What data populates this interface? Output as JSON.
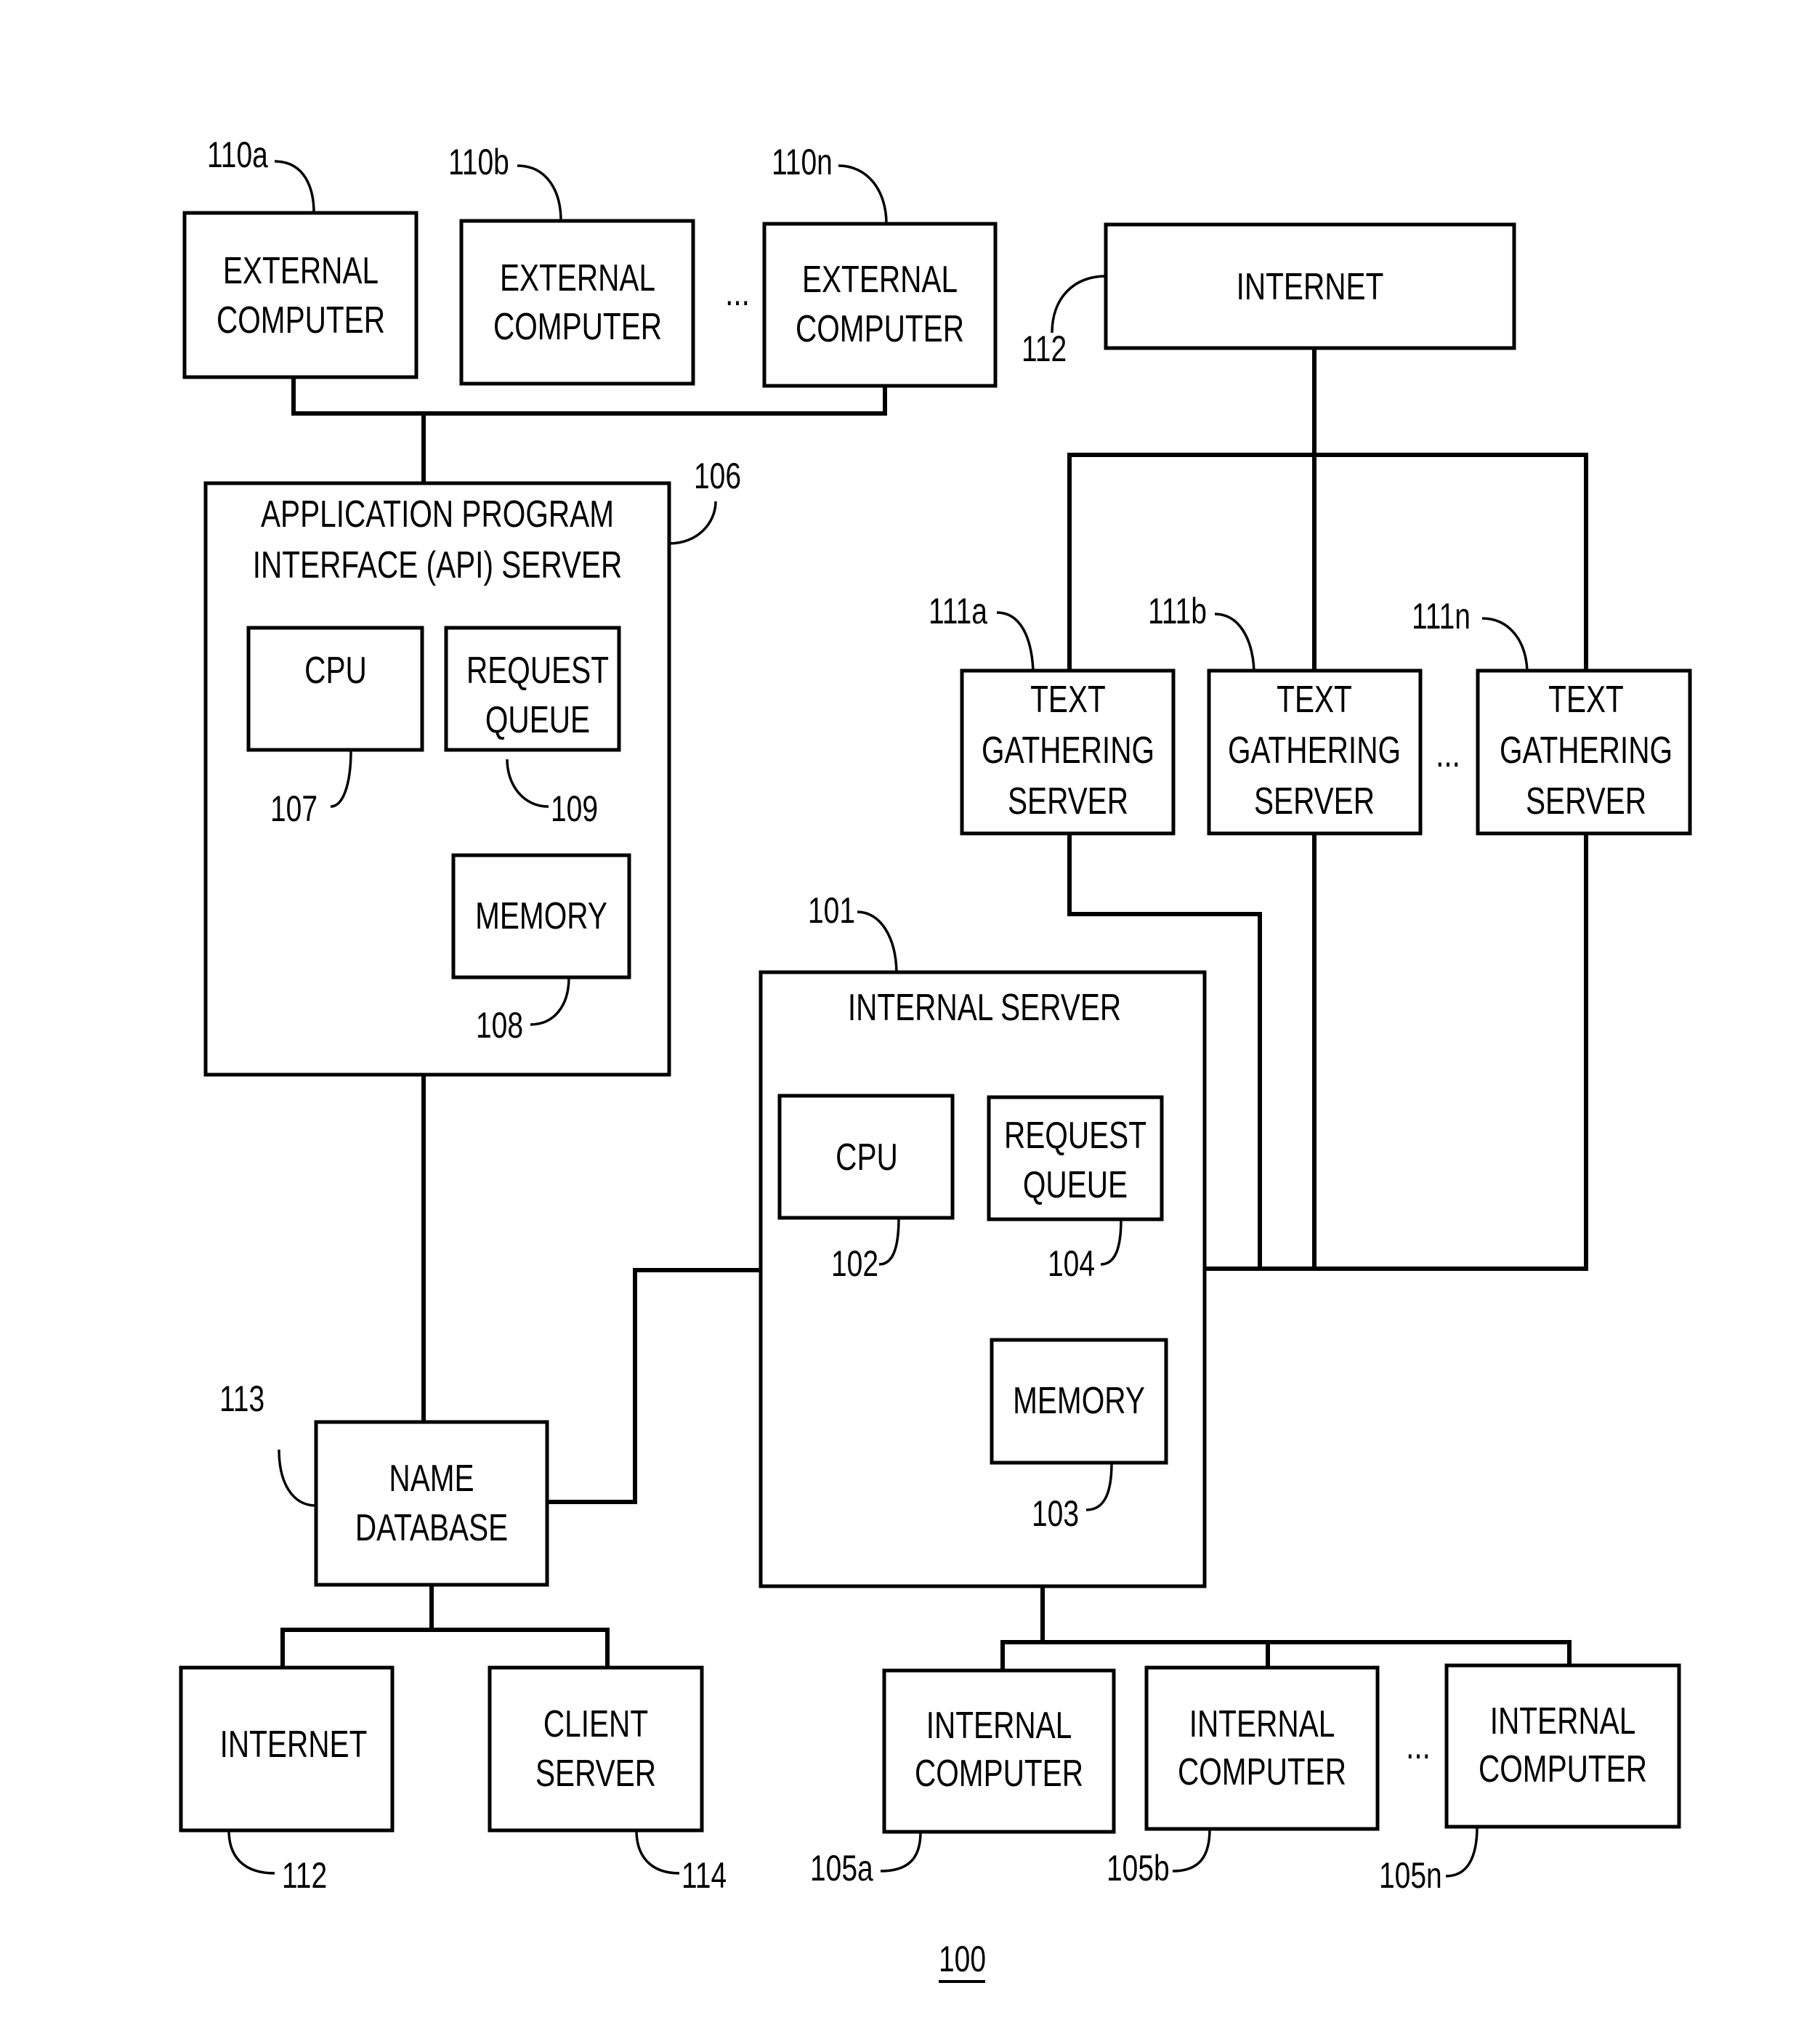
{
  "figure_number": "100",
  "ellipsis": "...",
  "external_computers": [
    {
      "ref": "110a",
      "lines": [
        "EXTERNAL",
        "COMPUTER"
      ]
    },
    {
      "ref": "110b",
      "lines": [
        "EXTERNAL",
        "COMPUTER"
      ]
    },
    {
      "ref": "110n",
      "lines": [
        "EXTERNAL",
        "COMPUTER"
      ]
    }
  ],
  "internet_top": {
    "ref": "112",
    "lines": [
      "INTERNET"
    ]
  },
  "text_gathering_servers": [
    {
      "ref": "111a",
      "lines": [
        "TEXT",
        "GATHERING",
        "SERVER"
      ]
    },
    {
      "ref": "111b",
      "lines": [
        "TEXT",
        "GATHERING",
        "SERVER"
      ]
    },
    {
      "ref": "111n",
      "lines": [
        "TEXT",
        "GATHERING",
        "SERVER"
      ]
    }
  ],
  "api_server": {
    "ref": "106",
    "lines": [
      "APPLICATION PROGRAM",
      "INTERFACE (API) SERVER"
    ],
    "cpu": {
      "ref": "107",
      "lines": [
        "CPU"
      ]
    },
    "request_queue": {
      "ref": "109",
      "lines": [
        "REQUEST",
        "QUEUE"
      ]
    },
    "memory": {
      "ref": "108",
      "lines": [
        "MEMORY"
      ]
    }
  },
  "internal_server": {
    "ref": "101",
    "lines": [
      "INTERNAL SERVER"
    ],
    "cpu": {
      "ref": "102",
      "lines": [
        "CPU"
      ]
    },
    "request_queue": {
      "ref": "104",
      "lines": [
        "REQUEST",
        "QUEUE"
      ]
    },
    "memory": {
      "ref": "103",
      "lines": [
        "MEMORY"
      ]
    }
  },
  "name_database": {
    "ref": "113",
    "lines": [
      "NAME",
      "DATABASE"
    ]
  },
  "internet_bottom": {
    "ref": "112",
    "lines": [
      "INTERNET"
    ]
  },
  "client_server": {
    "ref": "114",
    "lines": [
      "CLIENT",
      "SERVER"
    ]
  },
  "internal_computers": [
    {
      "ref": "105a",
      "lines": [
        "INTERNAL",
        "COMPUTER"
      ]
    },
    {
      "ref": "105b",
      "lines": [
        "INTERNAL",
        "COMPUTER"
      ]
    },
    {
      "ref": "105n",
      "lines": [
        "INTERNAL",
        "COMPUTER"
      ]
    }
  ]
}
